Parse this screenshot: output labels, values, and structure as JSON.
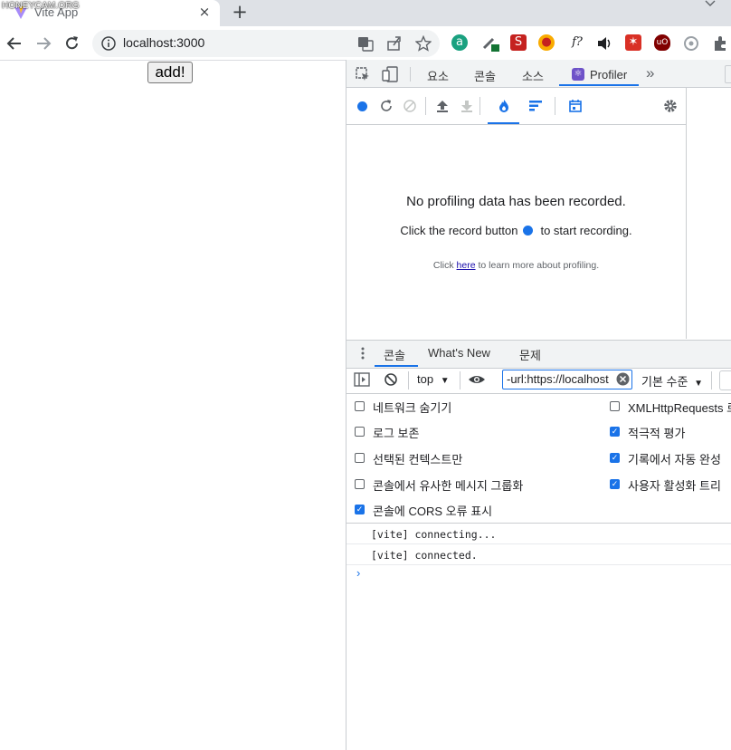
{
  "watermark": "HONEYCAM.ORG",
  "browser": {
    "tab_title": "Vite App",
    "close_glyph": "×",
    "new_tab_glyph": "+",
    "url": "localhost:3000"
  },
  "page": {
    "button_label": "add!"
  },
  "devtools": {
    "tabs": [
      "요소",
      "콘솔",
      "소스",
      "Profiler"
    ],
    "more_tabs": "»",
    "profiler": {
      "title": "No profiling data has been recorded.",
      "record_before": "Click the record button",
      "record_after": "to start recording.",
      "learn_before": "Click",
      "learn_link": "here",
      "learn_after": "to learn more about profiling."
    },
    "drawer_tabs": [
      "콘솔",
      "What's New",
      "문제"
    ],
    "console": {
      "context": "top",
      "filter_value": "-url:https://localhost",
      "levels": "기본 수준",
      "settings_left": [
        {
          "label": "네트워크 숨기기",
          "checked": false
        },
        {
          "label": "로그 보존",
          "checked": false
        },
        {
          "label": "선택된 컨텍스트만",
          "checked": false
        },
        {
          "label": "콘솔에서 유사한 메시지 그룹화",
          "checked": false
        },
        {
          "label": "콘솔에 CORS 오류 표시",
          "checked": true
        }
      ],
      "settings_right": [
        {
          "label": "XMLHttpRequests 로",
          "checked": false
        },
        {
          "label": "적극적 평가",
          "checked": true
        },
        {
          "label": "기록에서 자동 완성",
          "checked": true
        },
        {
          "label": "사용자 활성화 트리",
          "checked": true
        }
      ],
      "logs": [
        "[vite] connecting...",
        "[vite] connected."
      ],
      "prompt": "›"
    }
  },
  "colors": {
    "accent": "#1a73e8",
    "tabstrip": "#dee1e6"
  }
}
